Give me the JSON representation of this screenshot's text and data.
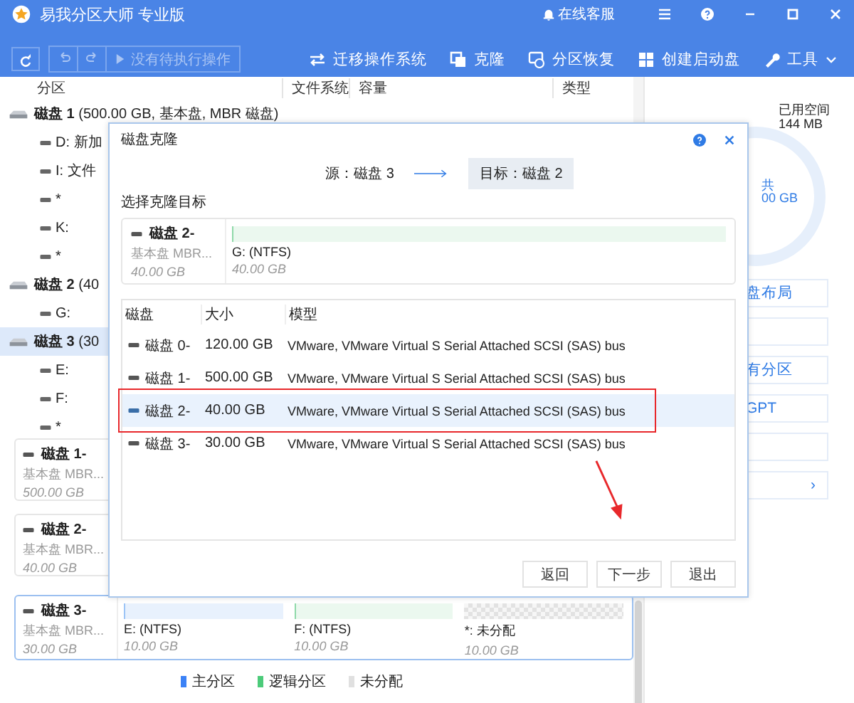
{
  "window": {
    "title": "易我分区大师 专业版",
    "support": "在线客服"
  },
  "toolbar": {
    "pending": "没有待执行操作",
    "pending_disabled": true,
    "actions": [
      {
        "kind": "migrate",
        "label": "迁移操作系统"
      },
      {
        "kind": "clone",
        "label": "克隆"
      },
      {
        "kind": "recover",
        "label": "分区恢复"
      },
      {
        "kind": "boot",
        "label": "创建启动盘"
      },
      {
        "kind": "tools",
        "label": "工具"
      }
    ]
  },
  "columns": [
    "分区",
    "文件系统",
    "容量",
    "类型"
  ],
  "tree": [
    {
      "label": "**磁盘 1** (500.00 GB, 基本盘, MBR 磁盘)",
      "selected": false,
      "children": [
        {
          "label": "D: 新加"
        },
        {
          "label": "I: 文件"
        },
        {
          "label": "*"
        },
        {
          "label": "K:"
        },
        {
          "label": "*"
        }
      ]
    },
    {
      "label": "**磁盘 2** (40",
      "selected": false,
      "children": [
        {
          "label": "G:"
        }
      ]
    },
    {
      "label": "**磁盘 3** (30",
      "selected": true,
      "children": [
        {
          "label": "E:"
        },
        {
          "label": "F:"
        },
        {
          "label": "*"
        }
      ]
    }
  ],
  "disk_cards": [
    {
      "name": "磁盘 1-",
      "type": "基本盘 MBR...",
      "size": "500.00 GB",
      "selected": false
    },
    {
      "name": "磁盘 2-",
      "type": "基本盘 MBR...",
      "size": "40.00 GB",
      "selected": false
    },
    {
      "name": "磁盘 3-",
      "type": "基本盘 MBR...",
      "size": "30.00 GB",
      "selected": true,
      "partitions": [
        {
          "kind": "primary",
          "label": "E:  (NTFS)",
          "size": "10.00 GB"
        },
        {
          "kind": "logical",
          "label": "F:  (NTFS)",
          "size": "10.00 GB"
        },
        {
          "kind": "unallocated",
          "label": "*: 未分配",
          "size": "10.00 GB"
        }
      ]
    }
  ],
  "legend": [
    {
      "label": "主分区",
      "color": "#3b82f6"
    },
    {
      "label": "逻辑分区",
      "color": "#4ccb7a"
    },
    {
      "label": "未分配",
      "color": "#e0e0e0"
    }
  ],
  "right_panel": {
    "used_label": "已用空间",
    "used_value": "144 MB",
    "total_label": "共",
    "total_value": "00 GB",
    "actions": [
      {
        "kind": "text",
        "label": "盘布局"
      },
      {
        "kind": "blank"
      },
      {
        "kind": "text",
        "label": "有分区"
      },
      {
        "kind": "text",
        "label": "GPT"
      },
      {
        "kind": "blank"
      },
      {
        "kind": "more",
        "label": "›"
      }
    ]
  },
  "dialog": {
    "title": "磁盘克隆",
    "source": "源：磁盘 3",
    "target": "目标：磁盘 2",
    "target_selected": true,
    "section": "选择克隆目标",
    "preview": {
      "name": "磁盘 2-",
      "type": "基本盘 MBR...",
      "size": "40.00 GB",
      "partitions": [
        {
          "kind": "logical",
          "label": "G:  (NTFS)",
          "size": "40.00 GB"
        }
      ]
    },
    "table": {
      "columns": [
        "磁盘",
        "大小",
        "模型"
      ],
      "rows": [
        {
          "disk": "磁盘 0-",
          "size": "120.00 GB",
          "model": "VMware,  VMware Virtual S Serial Attached SCSI (SAS) bus",
          "selected": false,
          "highlighted": false
        },
        {
          "disk": "磁盘 1-",
          "size": "500.00 GB",
          "model": "VMware,  VMware Virtual S Serial Attached SCSI (SAS) bus",
          "selected": false,
          "highlighted": false
        },
        {
          "disk": "磁盘 2-",
          "size": "40.00 GB",
          "model": "VMware,  VMware Virtual S Serial Attached SCSI (SAS) bus",
          "selected": true,
          "highlighted": true
        },
        {
          "disk": "磁盘 3-",
          "size": "30.00 GB",
          "model": "VMware,  VMware Virtual S Serial Attached SCSI (SAS) bus",
          "selected": false,
          "highlighted": false
        }
      ]
    },
    "buttons": [
      "返回",
      "下一步",
      "退出"
    ]
  }
}
